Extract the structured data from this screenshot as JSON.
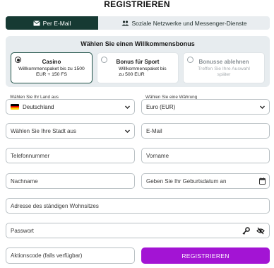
{
  "page": {
    "title": "REGISTRIEREN"
  },
  "tabs": [
    {
      "label": "Per E-Mail",
      "icon": "envelope-icon",
      "active": true
    },
    {
      "label": "Soziale Netzwerke und Messenger-Dienste",
      "icon": "users-icon",
      "active": false
    }
  ],
  "bonus": {
    "title": "Wählen Sie einen Willkommensbonus",
    "options": [
      {
        "name": "Casino",
        "description": "Willkommenspaket bis zu 1500 EUR + 150 FS",
        "selected": true
      },
      {
        "name": "Bonus für Sport",
        "description": "Willkommenspaket bis zu 500 EUR",
        "selected": false
      },
      {
        "name": "Bonusse ablehnen",
        "description": "Treffen Sie Ihre Auswahl später",
        "selected": false
      }
    ]
  },
  "form": {
    "country": {
      "label": "Wählen Sie Ihr Land aus",
      "value": "Deutschland",
      "flag_colors": [
        "#000000",
        "#dd0000",
        "#ffce00"
      ]
    },
    "currency": {
      "label": "Wählen Sie eine Währung",
      "value": "Euro (EUR)"
    },
    "city": {
      "placeholder": "Wählen Sie Ihre Stadt aus"
    },
    "email": {
      "placeholder": "E-Mail"
    },
    "phone": {
      "placeholder": "Telefonnummer"
    },
    "first_name": {
      "placeholder": "Vorname"
    },
    "last_name": {
      "placeholder": "Nachname"
    },
    "birthdate": {
      "placeholder": "Geben Sie Ihr Geburtsdatum an"
    },
    "address": {
      "placeholder": "Adresse des ständigen Wohnsitzes"
    },
    "password": {
      "placeholder": "Passwort"
    },
    "promo": {
      "placeholder": "Aktionscode (falls verfügbar)"
    },
    "submit_label": "REGISTRIEREN"
  },
  "colors": {
    "accent": "#a314d4",
    "tab_active": "#163a33",
    "panel": "#e7ecef"
  }
}
